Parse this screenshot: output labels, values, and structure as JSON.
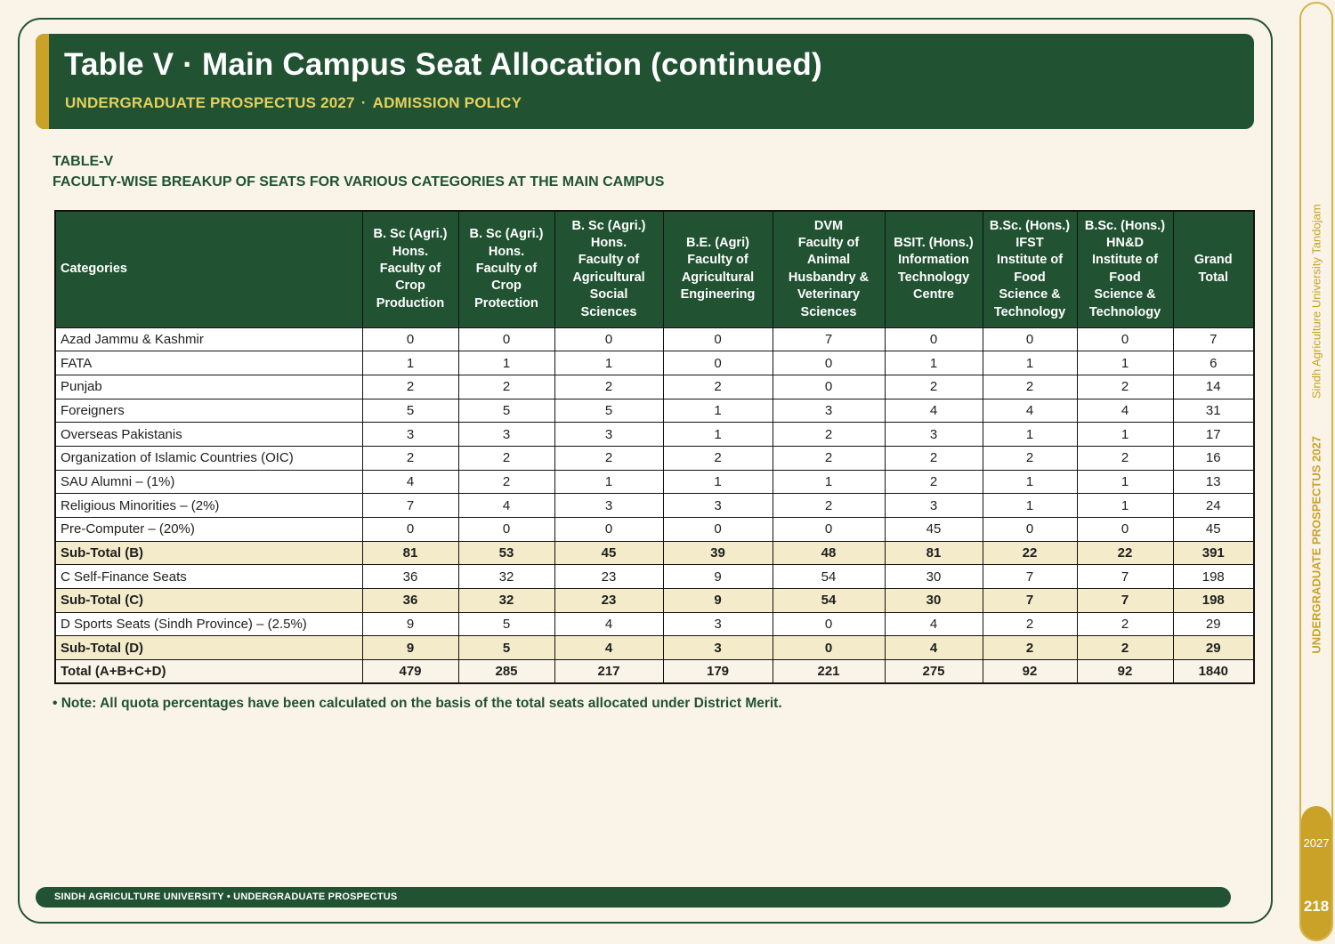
{
  "banner": {
    "title": "Table V · Main Campus Seat Allocation (continued)",
    "subtitle_left": "UNDERGRADUATE PROSPECTUS 2027",
    "subtitle_sep": "·",
    "subtitle_right": "ADMISSION POLICY"
  },
  "table_label": {
    "line1": "TABLE-V",
    "line2": "FACULTY-WISE BREAKUP OF SEATS FOR VARIOUS CATEGORIES AT THE MAIN CAMPUS"
  },
  "table": {
    "headers": [
      [
        "Categories"
      ],
      [
        "B. Sc (Agri.)",
        "Hons.",
        "Faculty of",
        "Crop",
        "Production"
      ],
      [
        "B. Sc (Agri.)",
        "Hons.",
        "Faculty of",
        "Crop",
        "Protection"
      ],
      [
        "B. Sc (Agri.)",
        "Hons.",
        "Faculty of",
        "Agricultural",
        "Social",
        "Sciences"
      ],
      [
        "B.E. (Agri)",
        "Faculty of",
        "Agricultural",
        "Engineering"
      ],
      [
        "DVM",
        "Faculty of",
        "Animal",
        "Husbandry &",
        "Veterinary",
        "Sciences"
      ],
      [
        "BSIT. (Hons.)",
        "Information",
        "Technology",
        "Centre"
      ],
      [
        "B.Sc. (Hons.)",
        "IFST",
        "Institute of",
        "Food",
        "Science &",
        "Technology"
      ],
      [
        "B.Sc. (Hons.)",
        "HN&D",
        "Institute of",
        "Food",
        "Science &",
        "Technology"
      ],
      [
        "Grand",
        "Total"
      ]
    ],
    "rows": [
      {
        "type": "normal",
        "cells": [
          "Azad Jammu & Kashmir",
          "0",
          "0",
          "0",
          "0",
          "7",
          "0",
          "0",
          "0",
          "7"
        ]
      },
      {
        "type": "normal",
        "cells": [
          "FATA",
          "1",
          "1",
          "1",
          "0",
          "0",
          "1",
          "1",
          "1",
          "6"
        ]
      },
      {
        "type": "normal",
        "cells": [
          "Punjab",
          "2",
          "2",
          "2",
          "2",
          "0",
          "2",
          "2",
          "2",
          "14"
        ]
      },
      {
        "type": "normal",
        "cells": [
          "Foreigners",
          "5",
          "5",
          "5",
          "1",
          "3",
          "4",
          "4",
          "4",
          "31"
        ]
      },
      {
        "type": "normal",
        "cells": [
          "Overseas Pakistanis",
          "3",
          "3",
          "3",
          "1",
          "2",
          "3",
          "1",
          "1",
          "17"
        ]
      },
      {
        "type": "normal",
        "cells": [
          "Organization of Islamic Countries (OIC)",
          "2",
          "2",
          "2",
          "2",
          "2",
          "2",
          "2",
          "2",
          "16"
        ]
      },
      {
        "type": "normal",
        "cells": [
          "SAU Alumni – (1%)",
          "4",
          "2",
          "1",
          "1",
          "1",
          "2",
          "1",
          "1",
          "13"
        ]
      },
      {
        "type": "normal",
        "cells": [
          "Religious Minorities – (2%)",
          "7",
          "4",
          "3",
          "3",
          "2",
          "3",
          "1",
          "1",
          "24"
        ]
      },
      {
        "type": "normal",
        "cells": [
          "Pre-Computer – (20%)",
          "0",
          "0",
          "0",
          "0",
          "0",
          "45",
          "0",
          "0",
          "45"
        ]
      },
      {
        "type": "sub",
        "cells": [
          "Sub-Total (B)",
          "81",
          "53",
          "45",
          "39",
          "48",
          "81",
          "22",
          "22",
          "391"
        ]
      },
      {
        "type": "normal",
        "cells": [
          "C  Self-Finance Seats",
          "36",
          "32",
          "23",
          "9",
          "54",
          "30",
          "7",
          "7",
          "198"
        ]
      },
      {
        "type": "sub",
        "cells": [
          "Sub-Total (C)",
          "36",
          "32",
          "23",
          "9",
          "54",
          "30",
          "7",
          "7",
          "198"
        ]
      },
      {
        "type": "normal",
        "cells": [
          "D  Sports Seats (Sindh Province) – (2.5%)",
          "9",
          "5",
          "4",
          "3",
          "0",
          "4",
          "2",
          "2",
          "29"
        ]
      },
      {
        "type": "sub",
        "cells": [
          "Sub-Total (D)",
          "9",
          "5",
          "4",
          "3",
          "0",
          "4",
          "2",
          "2",
          "29"
        ]
      },
      {
        "type": "total",
        "cells": [
          "Total (A+B+C+D)",
          "479",
          "285",
          "217",
          "179",
          "221",
          "275",
          "92",
          "92",
          "1840"
        ]
      }
    ]
  },
  "note": "• Note: All quota percentages have been calculated on the basis of the total seats allocated under District Merit.",
  "footer": {
    "left": "SINDH AGRICULTURE UNIVERSITY",
    "sep": "•",
    "right": "UNDERGRADUATE PROSPECTUS"
  },
  "side": {
    "prospectus": "UNDERGRADUATE PROSPECTUS 2027",
    "university": "Sindh Agriculture University Tandojam",
    "year": "2027",
    "page_number": "218"
  },
  "colors": {
    "primary_green": "#215232",
    "gold": "#c9a227",
    "subtotal_fill": "#f4ebcb",
    "background": "#faf4e8"
  }
}
